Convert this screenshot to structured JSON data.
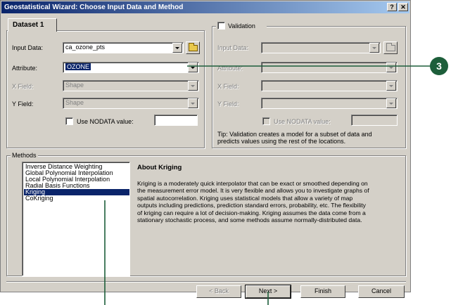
{
  "window": {
    "title": "Geostatistical Wizard: Choose Input Data and Method",
    "help_btn": "?",
    "close_btn": "✕"
  },
  "dataset": {
    "tab_label": "Dataset 1",
    "input_data_label": "Input Data:",
    "input_data_value": "ca_ozone_pts",
    "attribute_label": "Attribute:",
    "attribute_value": "OZONE",
    "xfield_label": "X Field:",
    "xfield_value": "Shape",
    "yfield_label": "Y Field:",
    "yfield_value": "Shape",
    "nodata_label": "Use NODATA value:"
  },
  "validation": {
    "label": "Validation",
    "input_data_label": "Input Data:",
    "attribute_label": "Attribute:",
    "xfield_label": "X Field:",
    "yfield_label": "Y Field:",
    "nodata_label": "Use NODATA value:",
    "tip_line1": "Tip:  Validation creates a model for a subset of data and",
    "tip_line2": "predicts values using the rest of the locations."
  },
  "methods": {
    "group_label": "Methods",
    "items": [
      "Inverse Distance Weighting",
      "Global Polynomial Interpolation",
      "Local Polynomial Interpolation",
      "Radial Basis Functions",
      "Kriging",
      "CoKriging"
    ],
    "selected_index": 4
  },
  "about": {
    "title": "About Kriging",
    "lines": [
      "Kriging is a moderately quick interpolator that can be exact or smoothed depending on",
      "the measurement error model. It is very flexible and allows you to investigate graphs of",
      "spatial autocorrelation. Kriging uses statistical models that allow a variety of map",
      "outputs including predictions, prediction standard errors, probability, etc. The flexibility",
      "of kriging can require a lot of decision-making. Kriging assumes the data come from a",
      "stationary stochastic process, and some methods assume normally-distributed data."
    ]
  },
  "buttons": {
    "back": "< Back",
    "next": "Next >",
    "finish": "Finish",
    "cancel": "Cancel"
  },
  "callout": {
    "number": "3",
    "color": "#1d5e3a"
  }
}
